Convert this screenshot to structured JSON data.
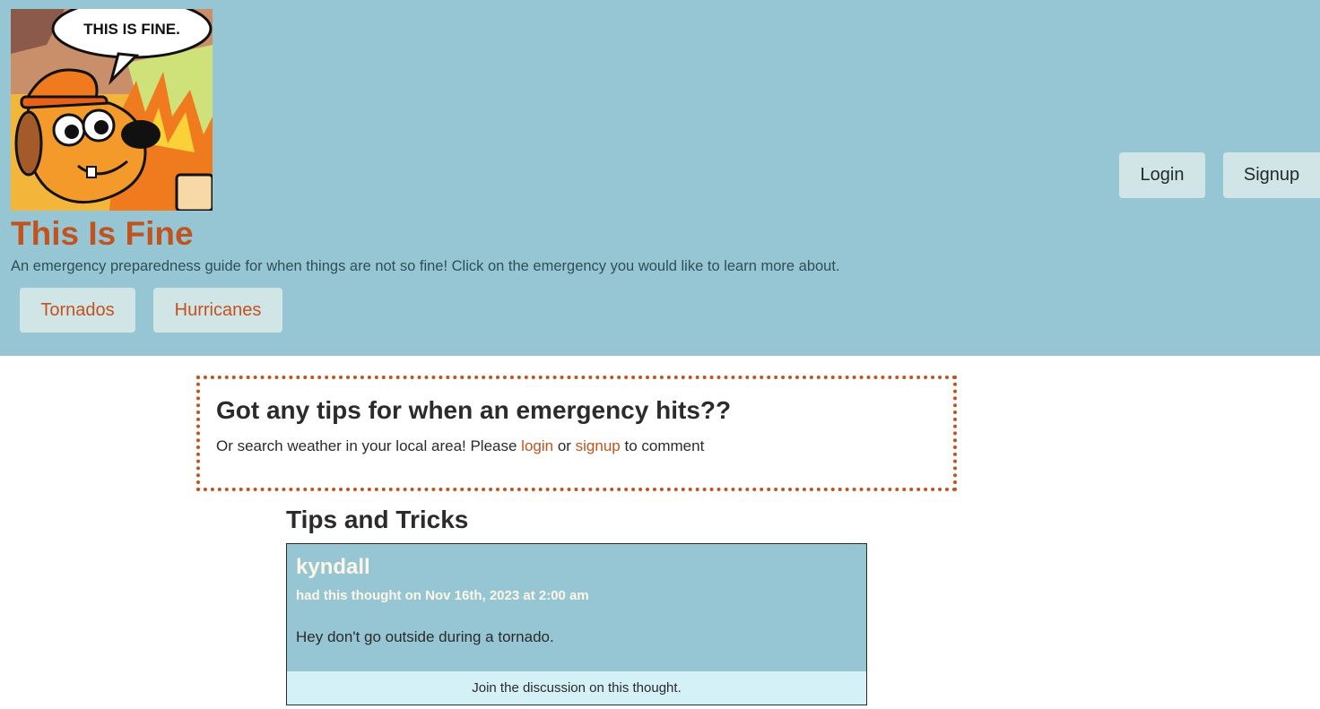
{
  "header": {
    "logo_icon": "this-is-fine-dog-meme",
    "logo_text": "THIS IS FINE.",
    "title": "This Is Fine",
    "subtitle": "An emergency preparedness guide for when things are not so fine! Click on the emergency you would like to learn more about.",
    "nav": {
      "tornados_label": "Tornados",
      "hurricanes_label": "Hurricanes"
    },
    "auth": {
      "login_label": "Login",
      "signup_label": "Signup"
    }
  },
  "tips_box": {
    "heading": "Got any tips for when an emergency hits??",
    "text_before": "Or search weather in your local area! Please ",
    "login_link": "login",
    "text_middle": " or ",
    "signup_link": "signup",
    "text_after": " to comment"
  },
  "thoughts": {
    "heading": "Tips and Tricks",
    "items": [
      {
        "author": "kyndall",
        "date": "had this thought on Nov 16th, 2023 at 2:00 am",
        "text": "Hey don't go outside during a tornado.",
        "footer": "Join the discussion on this thought."
      }
    ]
  },
  "colors": {
    "header_bg": "#96c6d4",
    "accent": "#c1531e",
    "button_bg": "#d2e5e6",
    "card_footer_bg": "#d3f1f7"
  }
}
